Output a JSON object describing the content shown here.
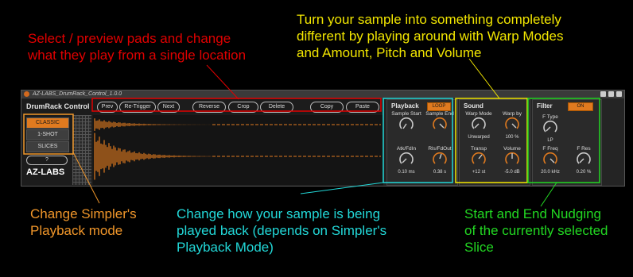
{
  "annotations": {
    "pads": "Select / preview pads and change\nwhat they play  from a single location",
    "warp": "Turn your sample into something completely\ndifferent by playing around with Warp Modes\nand Amount, Pitch and Volume",
    "playback_mode": "Change Simpler's\nPlayback mode",
    "playback": "Change how your sample is being\nplayed back (depends on Simpler's\nPlayback Mode)",
    "nudge": "Start and End Nudging\nof the currently selected\nSlice"
  },
  "colors": {
    "red": "#e00000",
    "yellow": "#f2e600",
    "orange": "#f0962a",
    "cyan": "#22d8d8",
    "green": "#22d822",
    "accent": "#e07a1f"
  },
  "device": {
    "window_title": "AZ-LABS_DrumRack_Control_1.0.0",
    "title": "DrumRack Control",
    "logo": "AZ-LABS",
    "help": "?",
    "buttons": [
      "Prev",
      "Re-Trigger",
      "Next",
      "Reverse",
      "Crop",
      "Delete",
      "Copy",
      "Paste"
    ],
    "modes": [
      "CLASSIC",
      "1-SHOT",
      "SLICES"
    ],
    "active_mode": "CLASSIC"
  },
  "playback": {
    "title": "Playback",
    "toggle": "LOOP",
    "knobs": [
      {
        "label": "Sample Start",
        "value": ""
      },
      {
        "label": "Sample End",
        "value": ""
      },
      {
        "label": "Atk/FdIn",
        "value": "0.10 ms"
      },
      {
        "label": "Rls/FdOut",
        "value": "0.38 s"
      }
    ]
  },
  "sound": {
    "title": "Sound",
    "knobs": [
      {
        "label": "Warp Mode",
        "value": "Unwarped"
      },
      {
        "label": "Warp by",
        "value": "100 %"
      },
      {
        "label": "Transp",
        "value": "+12 st"
      },
      {
        "label": "Volume",
        "value": "-5.0 dB"
      }
    ]
  },
  "filter": {
    "title": "Filter",
    "toggle": "ON",
    "knobs": [
      {
        "label": "F Type",
        "value": "LP"
      },
      {
        "label": "F Freq",
        "value": "20.0 kHz"
      },
      {
        "label": "F Res",
        "value": "0.20 %"
      }
    ]
  }
}
